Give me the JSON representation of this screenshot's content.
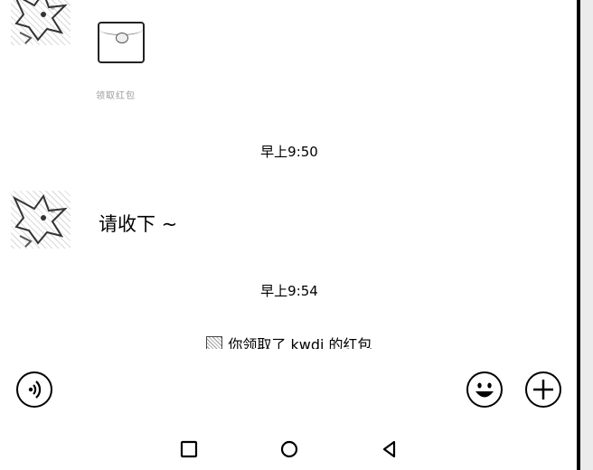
{
  "chat": {
    "gift_caption": "领取红包",
    "messages": [
      {
        "timestamp": "早上9:50",
        "text": "请收下 ~"
      },
      {
        "timestamp": "早上9:54",
        "system": "你领取了 kwdi 的红包"
      }
    ]
  },
  "input_bar": {
    "voice_icon": "voice-icon",
    "emoji_icon": "emoji-icon",
    "plus_icon": "plus-icon"
  },
  "nav_bar": {
    "recents_icon": "square-icon",
    "home_icon": "circle-icon",
    "back_icon": "triangle-back-icon"
  }
}
